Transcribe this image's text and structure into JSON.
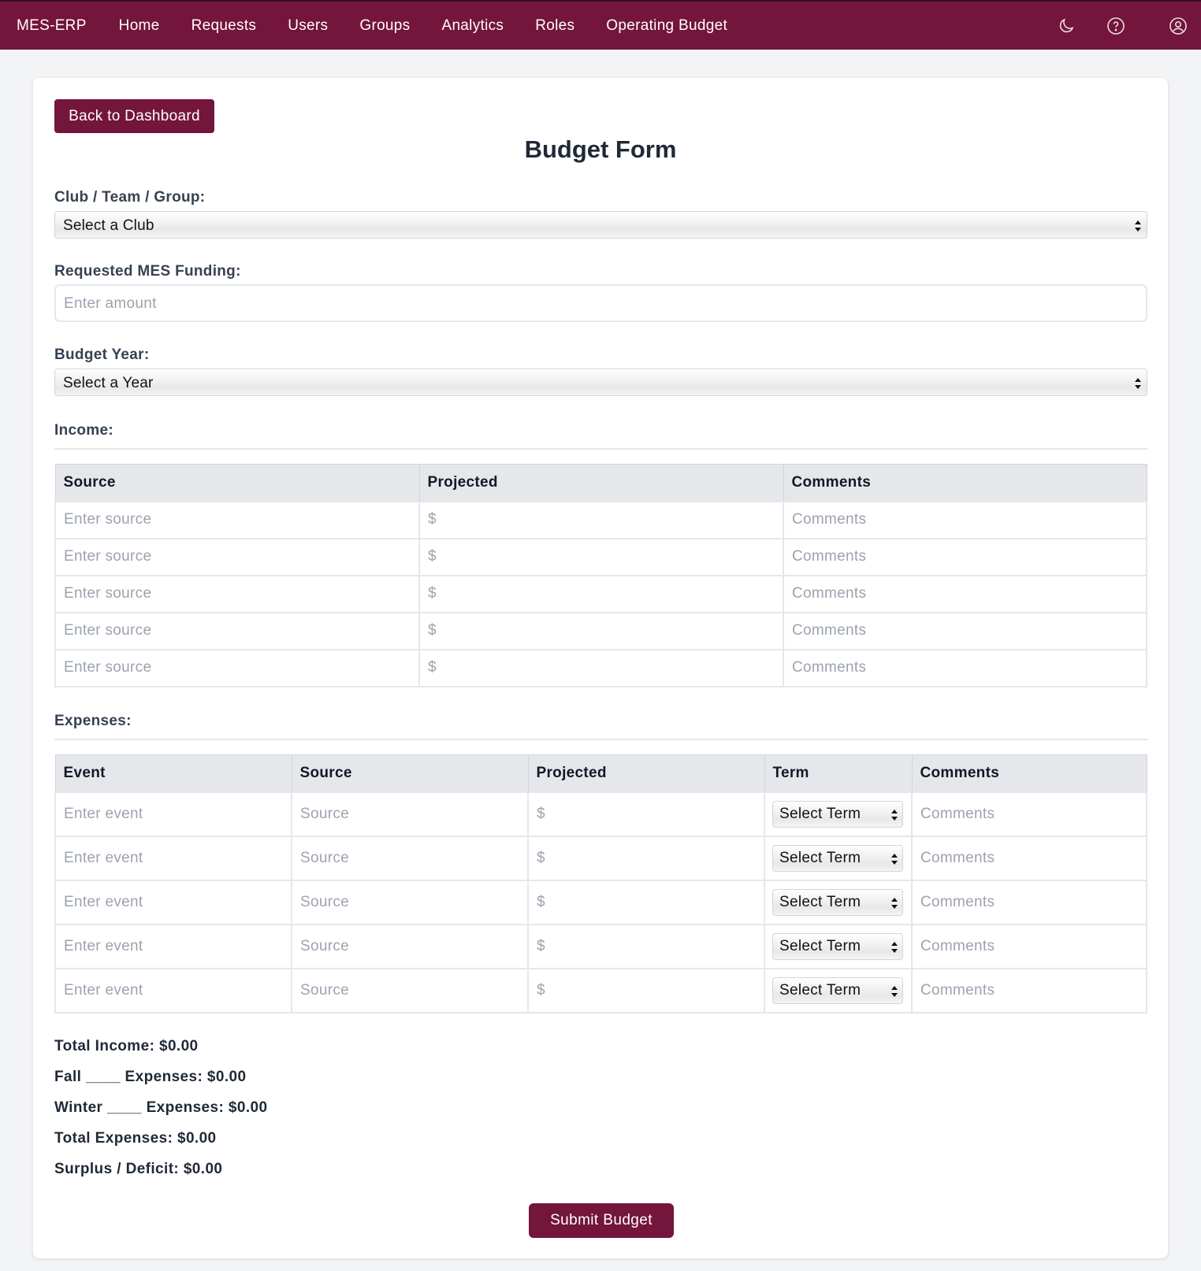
{
  "nav": {
    "brand": "MES-ERP",
    "links": [
      "Home",
      "Requests",
      "Users",
      "Groups",
      "Analytics",
      "Roles",
      "Operating Budget"
    ]
  },
  "form": {
    "back_label": "Back to Dashboard",
    "title": "Budget Form",
    "club_label": "Club / Team / Group:",
    "club_value": "Select a Club",
    "funding_label": "Requested MES Funding:",
    "funding_placeholder": "Enter amount",
    "year_label": "Budget Year:",
    "year_value": "Select a Year"
  },
  "income": {
    "heading": "Income:",
    "columns": [
      "Source",
      "Projected",
      "Comments"
    ],
    "rows": [
      [
        "Enter source",
        "$",
        "Comments"
      ],
      [
        "Enter source",
        "$",
        "Comments"
      ],
      [
        "Enter source",
        "$",
        "Comments"
      ],
      [
        "Enter source",
        "$",
        "Comments"
      ],
      [
        "Enter source",
        "$",
        "Comments"
      ]
    ]
  },
  "expenses": {
    "heading": "Expenses:",
    "columns": [
      "Event",
      "Source",
      "Projected",
      "Term",
      "Comments"
    ],
    "rows": [
      [
        "Enter event",
        "Source",
        "$",
        "Select Term",
        "Comments"
      ],
      [
        "Enter event",
        "Source",
        "$",
        "Select Term",
        "Comments"
      ],
      [
        "Enter event",
        "Source",
        "$",
        "Select Term",
        "Comments"
      ],
      [
        "Enter event",
        "Source",
        "$",
        "Select Term",
        "Comments"
      ],
      [
        "Enter event",
        "Source",
        "$",
        "Select Term",
        "Comments"
      ]
    ]
  },
  "summary": {
    "total_income": "Total Income: $0.00",
    "fall_expenses": "Fall ____ Expenses: $0.00",
    "winter_expenses": "Winter ____ Expenses: $0.00",
    "total_expenses": "Total Expenses: $0.00",
    "surplus_deficit": "Surplus / Deficit: $0.00"
  },
  "submit_label": "Submit Budget",
  "colors": {
    "brand": "#74153b",
    "background": "#f3f4f6"
  },
  "icons": [
    "moon-icon",
    "help-circle-icon",
    "user-circle-icon"
  ]
}
